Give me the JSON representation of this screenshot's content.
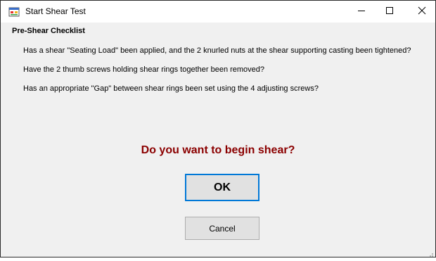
{
  "window": {
    "title": "Start Shear Test",
    "icons": {
      "app": "application-icon",
      "minimize": "minimize-icon",
      "maximize": "maximize-icon",
      "close": "close-icon"
    }
  },
  "checklist": {
    "header": "Pre-Shear Checklist",
    "items": [
      "Has a shear \"Seating Load\" been applied, and the 2 knurled nuts at the shear supporting casting been tightened?",
      "Have the 2 thumb screws holding shear rings together been removed?",
      "Has an appropriate \"Gap\" between shear rings been set using the 4 adjusting screws?"
    ]
  },
  "prompt": {
    "question": "Do you want to begin shear?"
  },
  "buttons": {
    "ok_label": "OK",
    "cancel_label": "Cancel"
  },
  "colors": {
    "question_text": "#8b0000",
    "default_button_border": "#0078d7",
    "dialog_background": "#f0f0f0"
  }
}
